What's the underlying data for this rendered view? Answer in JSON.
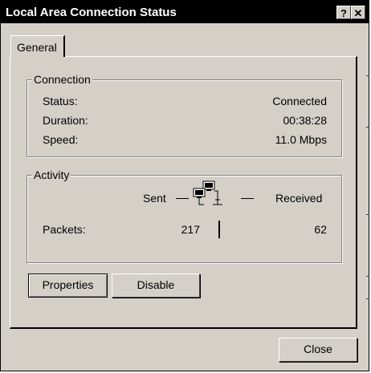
{
  "window": {
    "title": "Local Area Connection Status"
  },
  "titlebar": {
    "help_label": "?",
    "close_label": "✕"
  },
  "tabs": [
    {
      "label": "General"
    }
  ],
  "connection": {
    "legend": "Connection",
    "status_label": "Status:",
    "status_value": "Connected",
    "duration_label": "Duration:",
    "duration_value": "00:38:28",
    "speed_label": "Speed:",
    "speed_value": "11.0 Mbps"
  },
  "activity": {
    "legend": "Activity",
    "sent_label": "Sent",
    "received_label": "Received",
    "packets_label": "Packets:",
    "packets_sent": "217",
    "packets_received": "62",
    "icon": "network-computers-icon"
  },
  "buttons": {
    "properties": "Properties",
    "disable": "Disable",
    "close": "Close"
  }
}
